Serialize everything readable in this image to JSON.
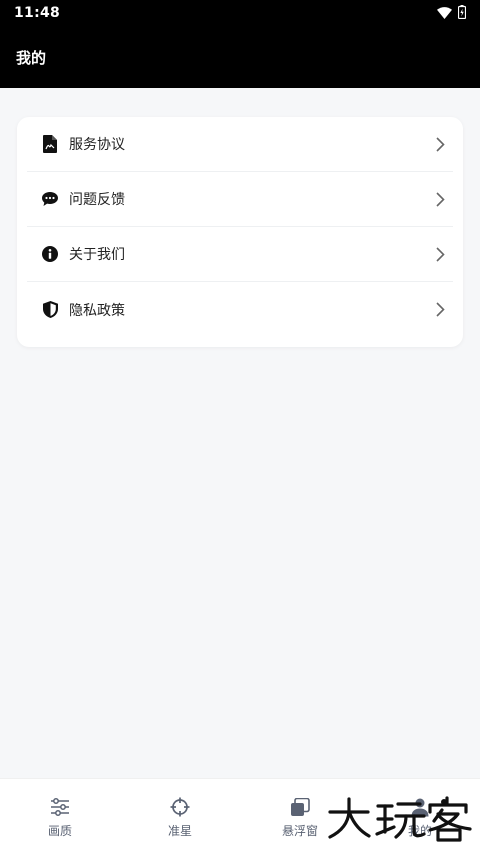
{
  "status_bar": {
    "time": "11:48"
  },
  "header": {
    "title": "我的"
  },
  "menu": {
    "items": [
      {
        "label": "服务协议",
        "icon": "document-icon"
      },
      {
        "label": "问题反馈",
        "icon": "chat-bubble-icon"
      },
      {
        "label": "关于我们",
        "icon": "info-icon"
      },
      {
        "label": "隐私政策",
        "icon": "shield-icon"
      }
    ]
  },
  "tabbar": {
    "items": [
      {
        "label": "画质",
        "icon": "sliders-icon"
      },
      {
        "label": "准星",
        "icon": "crosshair-icon"
      },
      {
        "label": "悬浮窗",
        "icon": "floating-window-icon"
      },
      {
        "label": "我的",
        "icon": "user-icon",
        "active": true
      }
    ]
  },
  "watermark": {
    "text": "大玩客"
  },
  "colors": {
    "header_bg": "#000000",
    "page_bg": "#f6f7f9",
    "tab_label": "#5a6273"
  }
}
